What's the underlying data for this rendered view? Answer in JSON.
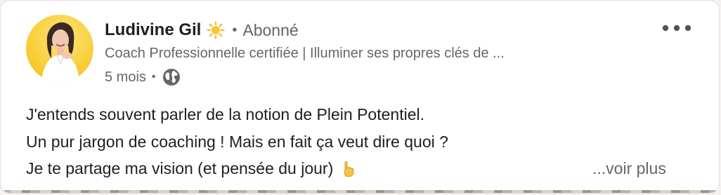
{
  "post": {
    "author": {
      "name": "Ludivine Gil",
      "badge_icon": "sun-icon",
      "separator": "•",
      "follow_status": "Abonné",
      "headline": "Coach Professionnelle certifiée | Illuminer ses propres clés de ...",
      "avatar_background": "#f9cf3c"
    },
    "meta": {
      "age": "5 mois",
      "separator": "•",
      "visibility_icon": "globe-icon"
    },
    "more_menu_icon": "more-horizontal-icon",
    "body_lines": [
      "J'entends souvent parler de la notion de Plein Potentiel.",
      "Un pur jargon de coaching ! Mais en fait ça veut dire quoi ?",
      "Je te partage ma vision (et pensée du jour)"
    ],
    "body_end_icon": "pointing-down-hand-icon",
    "see_more_label": "...voir plus"
  },
  "colors": {
    "text_primary": "#1f1f1f",
    "text_secondary": "#666666",
    "card_background": "#ffffff"
  }
}
